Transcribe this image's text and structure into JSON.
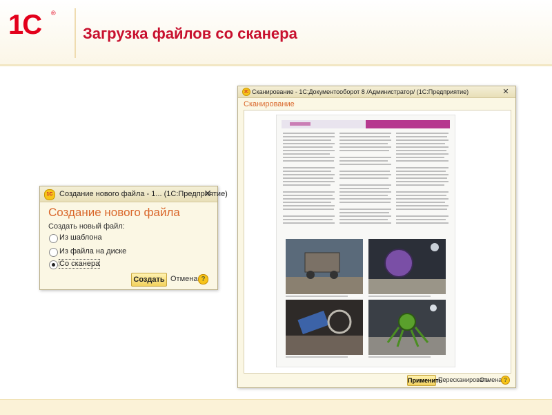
{
  "header": {
    "logo_text": "1С",
    "logo_mark": "®",
    "title": "Загрузка файлов со сканера"
  },
  "dialog": {
    "title": "Создание нового файла - 1... (1С:Предприятие)",
    "heading": "Создание нового файла",
    "prompt": "Создать новый файл:",
    "options": [
      {
        "label": "Из шаблона",
        "selected": false
      },
      {
        "label": "Из файла на диске",
        "selected": false
      },
      {
        "label": "Со сканера",
        "selected": true
      }
    ],
    "create_label": "Создать",
    "cancel_label": "Отмена",
    "help_label": "?"
  },
  "scan_window": {
    "title": "Сканирование - 1С:Документооборот 8 /Администратор/ (1С:Предприятие)",
    "heading": "Сканирование",
    "apply_label": "Применить",
    "rescan_label": "Пересканировать",
    "cancel_label": "Отмена",
    "help_label": "?"
  },
  "colors": {
    "brand_red": "#c8102e",
    "accent_orange": "#d9662a",
    "button_yellow": "#f3d15d",
    "header_band": "#fbf6e7"
  }
}
